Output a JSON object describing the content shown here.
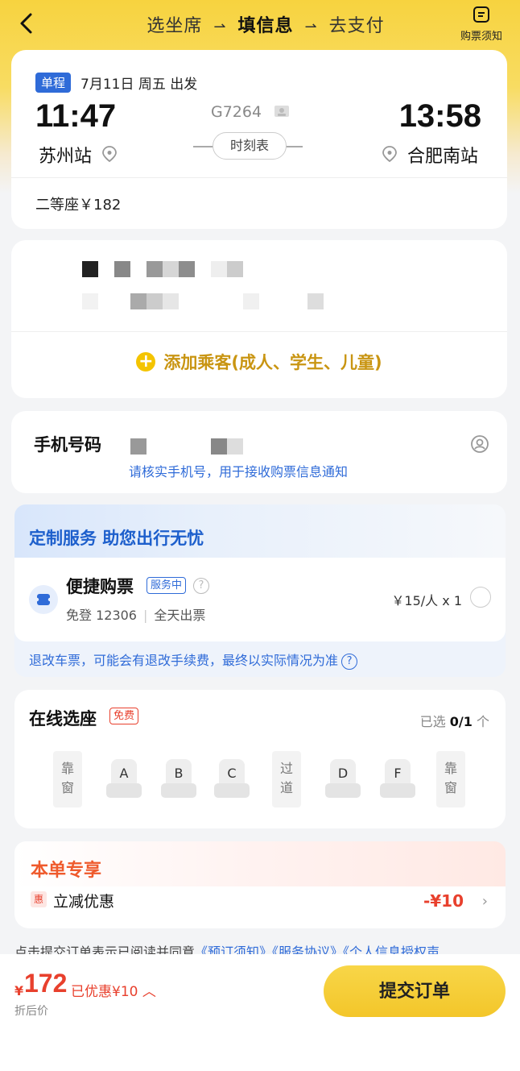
{
  "header": {
    "step1": "选坐席",
    "step2": "填信息",
    "step3": "去支付",
    "notice_label": "购票须知"
  },
  "train": {
    "trip_type": "单程",
    "date": "7月11日 周五 出发",
    "depart_time": "11:47",
    "arrive_time": "13:58",
    "train_no": "G7264",
    "timetable_label": "时刻表",
    "depart_station": "苏州站",
    "arrive_station": "合肥南站",
    "seat_price": "二等座￥182"
  },
  "passenger": {
    "add_label": "添加乘客(成人、学生、儿童)"
  },
  "phone": {
    "label": "手机号码",
    "hint": "请核实手机号，用于接收购票信息通知"
  },
  "service": {
    "title": "定制服务 助您出行无忧",
    "name": "便捷购票",
    "badge": "服务中",
    "desc1": "免登 12306",
    "desc2": "全天出票",
    "price": "￥15/人 x 1",
    "refund_note": "退改车票，可能会有退改手续费，最终以实际情况为准"
  },
  "seat_select": {
    "title": "在线选座",
    "free_badge": "免费",
    "count_prefix": "已选 ",
    "count": "0/1",
    "count_suffix": " 个",
    "window": "靠窗",
    "aisle": "过道",
    "letters": [
      "A",
      "B",
      "C",
      "D",
      "F"
    ]
  },
  "exclusive": {
    "title": "本单专享",
    "hui": "惠",
    "discount_label": "立减优惠",
    "discount_value": "-¥10"
  },
  "agreement": {
    "prefix": "点击提交订单表示已阅读并同意",
    "link1": "《预订须知》",
    "link2": "《服务协议》",
    "link3": "《个人信息授权声"
  },
  "footer": {
    "currency": "¥",
    "price": "172",
    "discounted": "已优惠¥10",
    "after_label": "折后价",
    "submit": "提交订单"
  },
  "colors": {
    "brand_yellow": "#f4c400",
    "blue": "#2f6bd8",
    "red": "#e8402d"
  }
}
